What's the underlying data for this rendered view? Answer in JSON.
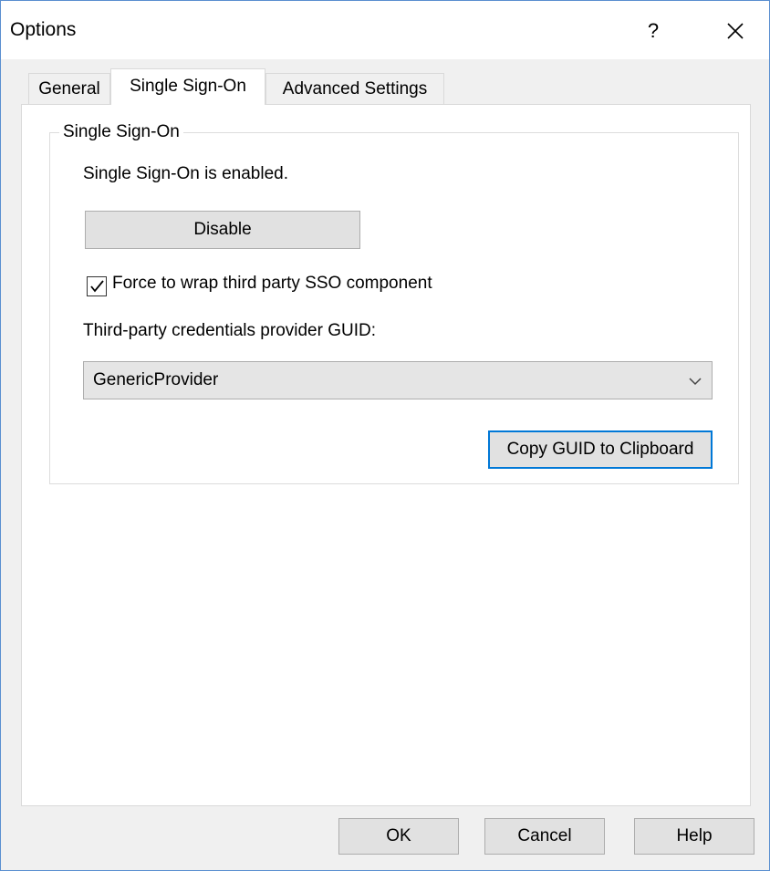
{
  "window": {
    "title": "Options",
    "help_glyph": "?",
    "close_icon": "close-icon"
  },
  "tabs": [
    {
      "label": "General",
      "active": false
    },
    {
      "label": "Single Sign-On",
      "active": true
    },
    {
      "label": "Advanced Settings",
      "active": false
    }
  ],
  "sso": {
    "group_title": "Single Sign-On",
    "status": "Single Sign-On is enabled.",
    "disable_label": "Disable",
    "force_wrap": {
      "label": "Force to wrap third party SSO component",
      "checked": true
    },
    "guid_label": "Third-party credentials provider GUID:",
    "provider_value": "GenericProvider",
    "copy_label": "Copy GUID to Clipboard"
  },
  "footer": {
    "ok_label": "OK",
    "cancel_label": "Cancel",
    "help_label": "Help"
  },
  "colors": {
    "window_border": "#5a8fd0",
    "focus_border": "#0078d7",
    "button_face": "#e1e1e1",
    "dialog_bg": "#f0f0f0"
  }
}
